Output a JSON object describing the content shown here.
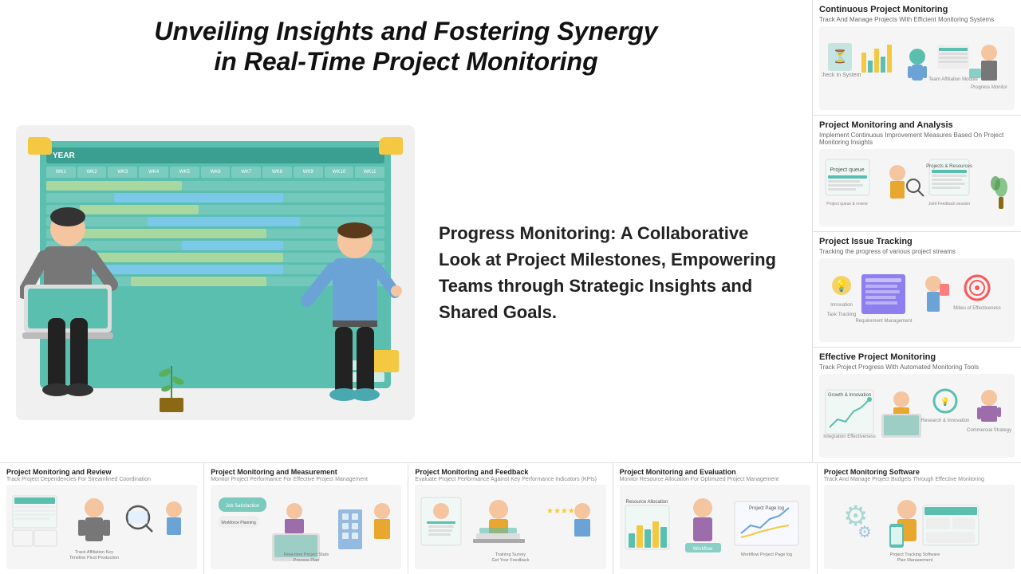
{
  "header": {
    "title_line1": "Unveiling Insights and Fostering Synergy",
    "title_line2": "in Real-Time Project Monitoring"
  },
  "hero": {
    "description": "Progress Monitoring: A Collaborative Look at Project Milestones, Empowering Teams through Strategic Insights and Shared Goals.",
    "gantt": {
      "year_label": "YEAR",
      "weeks": [
        "WK 1",
        "WK 2",
        "WK 3",
        "WK 4",
        "WK 5",
        "WK 6",
        "WK 7",
        "WK 8",
        "WK 9",
        "WK 10",
        "WK 11"
      ]
    }
  },
  "sidebar": {
    "cards": [
      {
        "title": "Continuous Project Monitoring",
        "subtitle": "Track And Manage Projects With Efficient Monitoring Systems"
      },
      {
        "title": "Project Monitoring and Analysis",
        "subtitle": "Implement Continuous Improvement Measures Based On Project Monitoring Insights"
      },
      {
        "title": "Project Issue Tracking",
        "subtitle": "Tracking the progress of various project streams"
      },
      {
        "title": "Effective Project Monitoring",
        "subtitle": "Track Project Progress With Automated Monitoring Tools"
      }
    ]
  },
  "bottom_cards": [
    {
      "title": "Project Monitoring and Review",
      "subtitle": "Track Project Dependencies For Streamlined Coordination"
    },
    {
      "title": "Project Monitoring and Measurement",
      "subtitle": "Monitor Project Performance For Effective Project Management"
    },
    {
      "title": "Project Monitoring and Feedback",
      "subtitle": "Evaluate Project Performance Against Key Performance Indicators (KPIs)"
    },
    {
      "title": "Project Monitoring and Evaluation",
      "subtitle": "Monitor Resource Allocation For Optimized Project Management"
    },
    {
      "title": "Project Monitoring Software",
      "subtitle": "Track And Manage Project Budgets Through Effective Monitoring"
    }
  ]
}
